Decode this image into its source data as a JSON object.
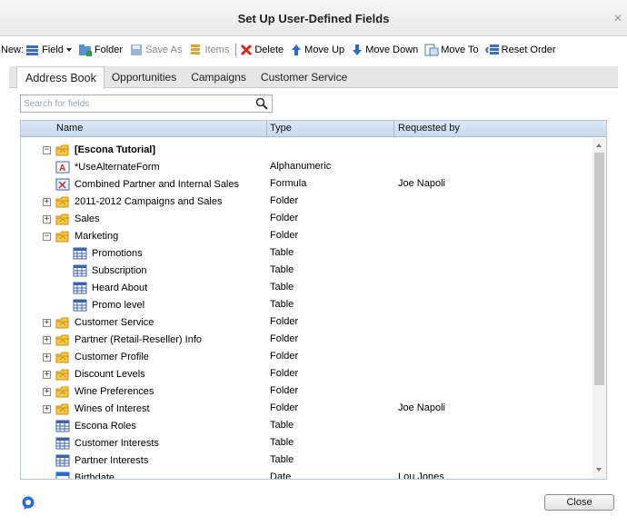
{
  "window": {
    "title": "Set Up User-Defined Fields"
  },
  "toolbar": {
    "new_label": "New:",
    "field": "Field",
    "folder": "Folder",
    "save_as": "Save As",
    "items": "Items",
    "delete": "Delete",
    "move_up": "Move Up",
    "move_down": "Move Down",
    "move_to": "Move To",
    "reset_order": "Reset Order"
  },
  "tabs": [
    "Address Book",
    "Opportunities",
    "Campaigns",
    "Customer Service"
  ],
  "search": {
    "placeholder": "Search for fields",
    "value": ""
  },
  "grid": {
    "columns": [
      "Name",
      "Type",
      "Requested by"
    ],
    "rows": [
      {
        "name": "[Escona Tutorial]",
        "type": "",
        "requested_by": "",
        "icon": "folder-icon",
        "expander": "collapse"
      },
      {
        "name": "*UseAlternateForm",
        "type": "Alphanumeric",
        "requested_by": "",
        "icon": "alphanumeric-field-icon",
        "expander": ""
      },
      {
        "name": "Combined Partner and Internal Sales",
        "type": "Formula",
        "requested_by": "Joe Napoli",
        "icon": "formula-field-icon",
        "expander": ""
      },
      {
        "name": "2011-2012 Campaigns and Sales",
        "type": "Folder",
        "requested_by": "",
        "icon": "folder-icon",
        "expander": "expand"
      },
      {
        "name": "Sales",
        "type": "Folder",
        "requested_by": "",
        "icon": "folder-icon",
        "expander": "expand"
      },
      {
        "name": "Marketing",
        "type": "Folder",
        "requested_by": "",
        "icon": "folder-icon",
        "expander": "collapse"
      },
      {
        "name": "Promotions",
        "type": "Table",
        "requested_by": "",
        "icon": "table-icon",
        "expander": ""
      },
      {
        "name": "Subscription",
        "type": "Table",
        "requested_by": "",
        "icon": "table-icon",
        "expander": ""
      },
      {
        "name": "Heard About",
        "type": "Table",
        "requested_by": "",
        "icon": "table-icon",
        "expander": ""
      },
      {
        "name": "Promo level",
        "type": "Table",
        "requested_by": "",
        "icon": "table-icon",
        "expander": ""
      },
      {
        "name": "Customer Service",
        "type": "Folder",
        "requested_by": "",
        "icon": "folder-icon",
        "expander": "expand"
      },
      {
        "name": "Partner (Retail-Reseller) Info",
        "type": "Folder",
        "requested_by": "",
        "icon": "folder-icon",
        "expander": "expand"
      },
      {
        "name": "Customer Profile",
        "type": "Folder",
        "requested_by": "",
        "icon": "folder-icon",
        "expander": "expand"
      },
      {
        "name": "Discount Levels",
        "type": "Folder",
        "requested_by": "",
        "icon": "folder-icon",
        "expander": "expand"
      },
      {
        "name": "Wine Preferences",
        "type": "Folder",
        "requested_by": "",
        "icon": "folder-icon",
        "expander": "expand"
      },
      {
        "name": "Wines of Interest",
        "type": "Folder",
        "requested_by": "Joe Napoli",
        "icon": "folder-icon",
        "expander": "expand"
      },
      {
        "name": "Escona Roles",
        "type": "Table",
        "requested_by": "",
        "icon": "table-icon",
        "expander": ""
      },
      {
        "name": "Customer Interests",
        "type": "Table",
        "requested_by": "",
        "icon": "table-icon",
        "expander": ""
      },
      {
        "name": "Partner Interests",
        "type": "Table",
        "requested_by": "",
        "icon": "table-icon",
        "expander": ""
      },
      {
        "name": "Birthdate",
        "type": "Date",
        "requested_by": "Lou Jones",
        "icon": "date-field-icon",
        "expander": ""
      }
    ]
  },
  "footer": {
    "close_label": "Close"
  }
}
